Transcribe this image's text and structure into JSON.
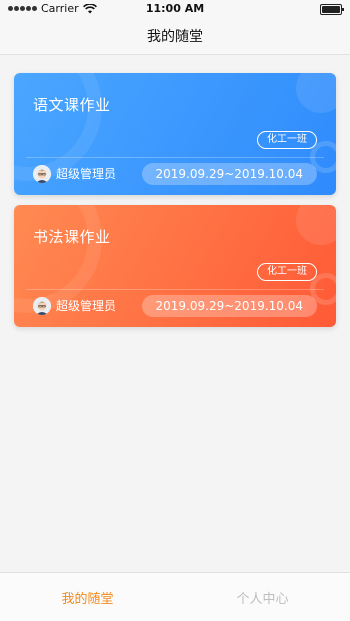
{
  "status_bar": {
    "carrier": "Carrier",
    "time": "11:00 AM"
  },
  "nav": {
    "title": "我的随堂"
  },
  "cards": [
    {
      "title": "语文课作业",
      "class_name": "化工一班",
      "teacher": "超级管理员",
      "date_range": "2019.09.29~2019.10.04",
      "color": "#3d98fd"
    },
    {
      "title": "书法课作业",
      "class_name": "化工一班",
      "teacher": "超级管理员",
      "date_range": "2019.09.29~2019.10.04",
      "color": "#ff6b40"
    }
  ],
  "tabs": [
    {
      "label": "我的随堂",
      "active": true,
      "color": "#f08a1c"
    },
    {
      "label": "个人中心",
      "active": false,
      "color": "#bdbdbd"
    }
  ]
}
